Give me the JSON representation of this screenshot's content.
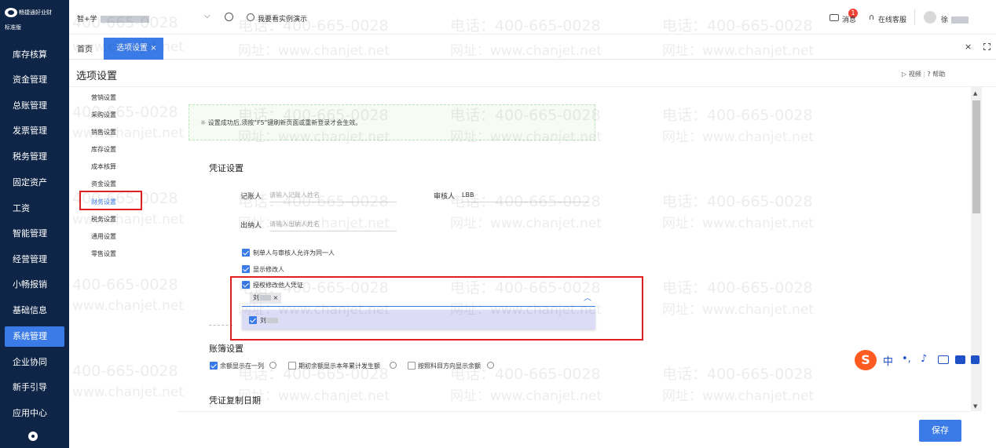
{
  "sidebar": {
    "logo_text": "畅捷通好业财",
    "edition": "标准版",
    "items": [
      {
        "label": "库存核算",
        "active": false
      },
      {
        "label": "资金管理",
        "active": false
      },
      {
        "label": "总账管理",
        "active": false
      },
      {
        "label": "发票管理",
        "active": false
      },
      {
        "label": "税务管理",
        "active": false
      },
      {
        "label": "固定资产",
        "active": false
      },
      {
        "label": "工资",
        "active": false
      },
      {
        "label": "智能管理",
        "active": false
      },
      {
        "label": "经营管理",
        "active": false
      },
      {
        "label": "小畅报销",
        "active": false
      },
      {
        "label": "基础信息",
        "active": false
      },
      {
        "label": "系统管理",
        "active": true
      },
      {
        "label": "企业协同",
        "active": false
      },
      {
        "label": "新手引导",
        "active": false
      },
      {
        "label": "应用中心",
        "active": false
      }
    ],
    "settings_icon": "gear-icon"
  },
  "topbar": {
    "account_prefix": "智+学",
    "demo_link": "我要看实例演示",
    "messages": "消息",
    "message_badge": "1",
    "service": "在线客服",
    "user": "徐"
  },
  "tabs": {
    "home": "首页",
    "active": "选项设置",
    "close": "×"
  },
  "page": {
    "title": "选项设置",
    "video": "视频",
    "help": "帮助"
  },
  "nav_items": [
    "营销设置",
    "采购设置",
    "销售设置",
    "库存设置",
    "成本核算",
    "资金设置",
    "财务设置",
    "税务设置",
    "通用设置",
    "零售设置"
  ],
  "notice": "设置成功后,须按\"F5\"键刷新页面或重新登录才会生效。",
  "voucher": {
    "title": "凭证设置",
    "bookkeeper_label": "记账人",
    "bookkeeper_placeholder": "请输入记账人姓名",
    "reviewer_label": "审核人",
    "reviewer_value": "LBB",
    "cashier_label": "出纳人",
    "cashier_placeholder": "请输入出纳人姓名",
    "opt1": "制单人与审核人允许为同一人",
    "opt2": "显示修改人",
    "opt3": "授权修改他人凭证",
    "tag": "刘",
    "dropdown_item": "刘"
  },
  "ledger": {
    "title": "账簿设置",
    "opt1": "余额显示在一列",
    "opt2": "期初余额显示本年累计发生额",
    "opt3": "按照科目方向显示余额"
  },
  "copy_date_title": "凭证复制日期",
  "save_label": "保存",
  "ime": {
    "lang": "中",
    "punct": "•,"
  },
  "watermark": {
    "phone": "电话：400-665-0028",
    "url": "网址：www.chanjet.net",
    "phone_short": "400-665-0028",
    "url_short": "www.chanjet.net"
  }
}
